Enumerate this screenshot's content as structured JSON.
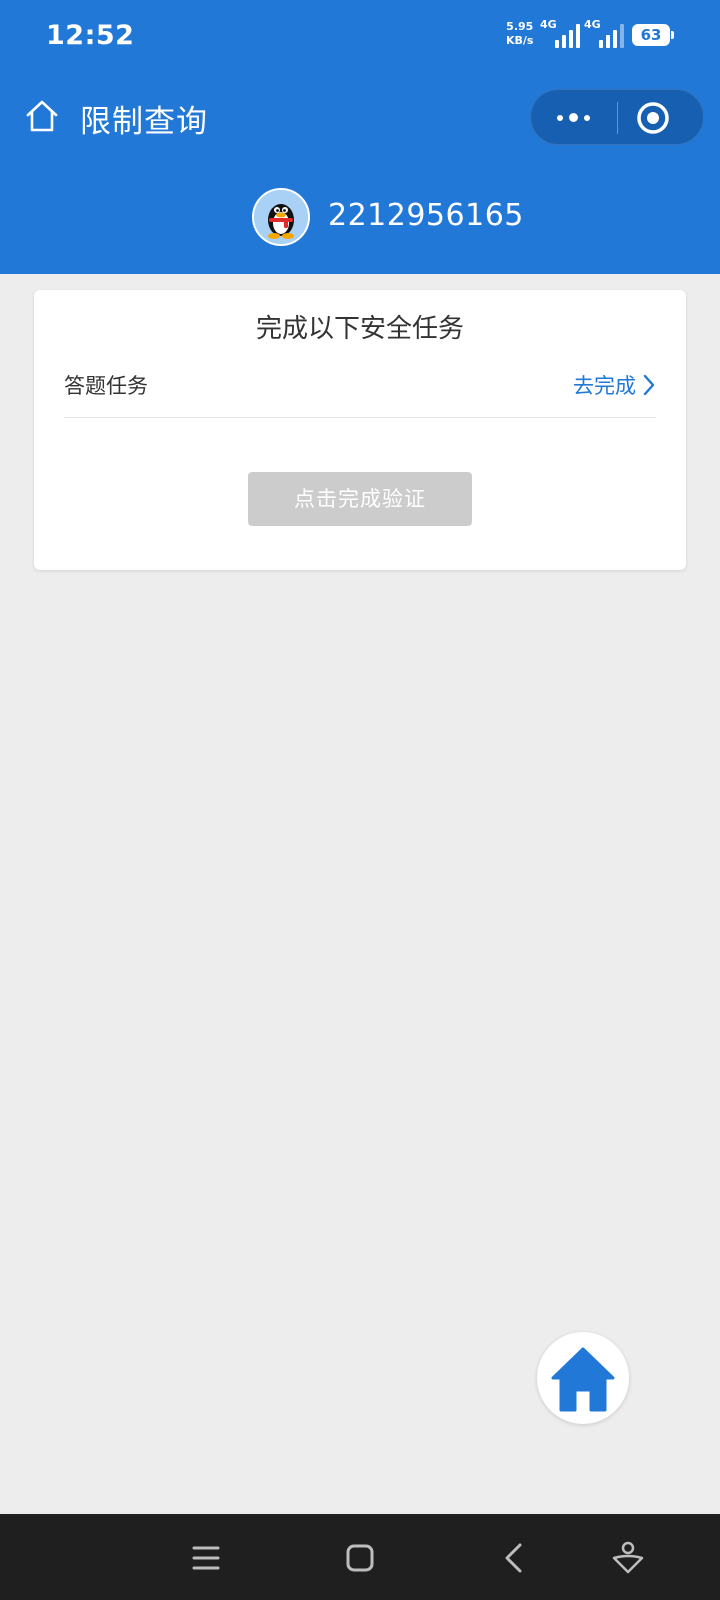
{
  "status_bar": {
    "time": "12:52",
    "net_speed_value": "5.95",
    "net_speed_unit": "KB/s",
    "sim1_type": "4G",
    "sim2_type": "4G",
    "battery": "63"
  },
  "header": {
    "title": "限制查询",
    "account_id": "2212956165",
    "home_icon": "home-outline-icon",
    "more_icon": "more-dots-icon",
    "close_icon": "target-close-icon"
  },
  "card": {
    "title": "完成以下安全任务",
    "task": {
      "label": "答题任务",
      "action": "去完成"
    },
    "verify_button": "点击完成验证"
  },
  "colors": {
    "brand_blue": "#2278d6",
    "disabled_button": "#cccccc",
    "background": "#ededed"
  },
  "nav_icons": [
    "menu-icon",
    "square-home-icon",
    "back-icon",
    "assistant-icon"
  ]
}
